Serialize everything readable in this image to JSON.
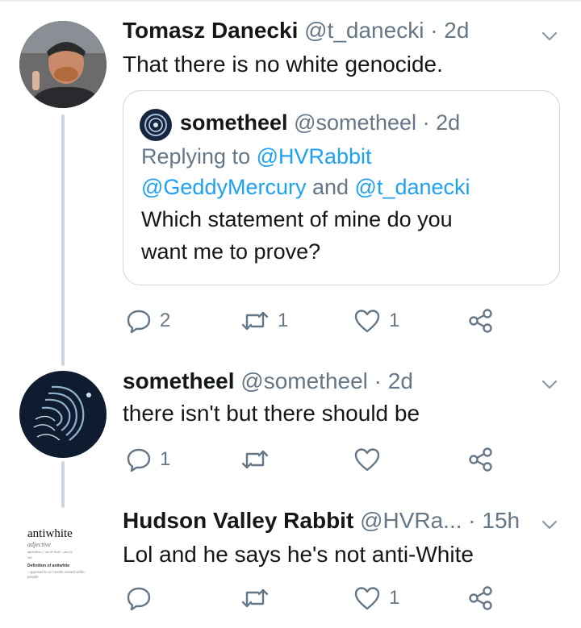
{
  "tweets": [
    {
      "name": "Tomasz Danecki",
      "handle": "@t_danecki",
      "time": "· 2d",
      "text": "That there is no white genocide.",
      "quote": {
        "name": "sometheel",
        "handle": "@sometheel",
        "time": "· 2d",
        "replying_prefix": "Replying to ",
        "replying_to_1": "@HVRabbit",
        "replying_to_2": "@GeddyMercury",
        "replying_and": " and ",
        "replying_to_3": "@t_danecki",
        "text_line1": "Which statement of mine do you",
        "text_line2": "want me to prove?"
      },
      "reply_count": "2",
      "retweet_count": "1",
      "like_count": "1"
    },
    {
      "name": "sometheel",
      "handle": "@sometheel",
      "time": "· 2d",
      "text": "there isn't but there should be",
      "reply_count": "1",
      "retweet_count": "",
      "like_count": ""
    },
    {
      "name": "Hudson Valley Rabbit",
      "handle": "@HVRa...",
      "time": "· 15h",
      "text": "Lol and he says he's not anti-White",
      "reply_count": "",
      "retweet_count": "",
      "like_count": "1",
      "avatar": {
        "word": "antiwhite",
        "pos": "adjective",
        "pron": "antiwhite | \\ an-tē-hwīt \\ ,an-,tī-",
        "pron2": "wīt",
        "def_heading": "Definition of antiwhite",
        "def_text": ": opposed to or hostile toward white people"
      }
    }
  ],
  "icons": {
    "reply": "reply-icon",
    "retweet": "retweet-icon",
    "like": "heart-icon",
    "share": "share-icon",
    "caret": "chevron-down-icon"
  },
  "colors": {
    "text": "#14171a",
    "secondary": "#657786",
    "link": "#1da1f2",
    "border": "#ccd6dd"
  }
}
